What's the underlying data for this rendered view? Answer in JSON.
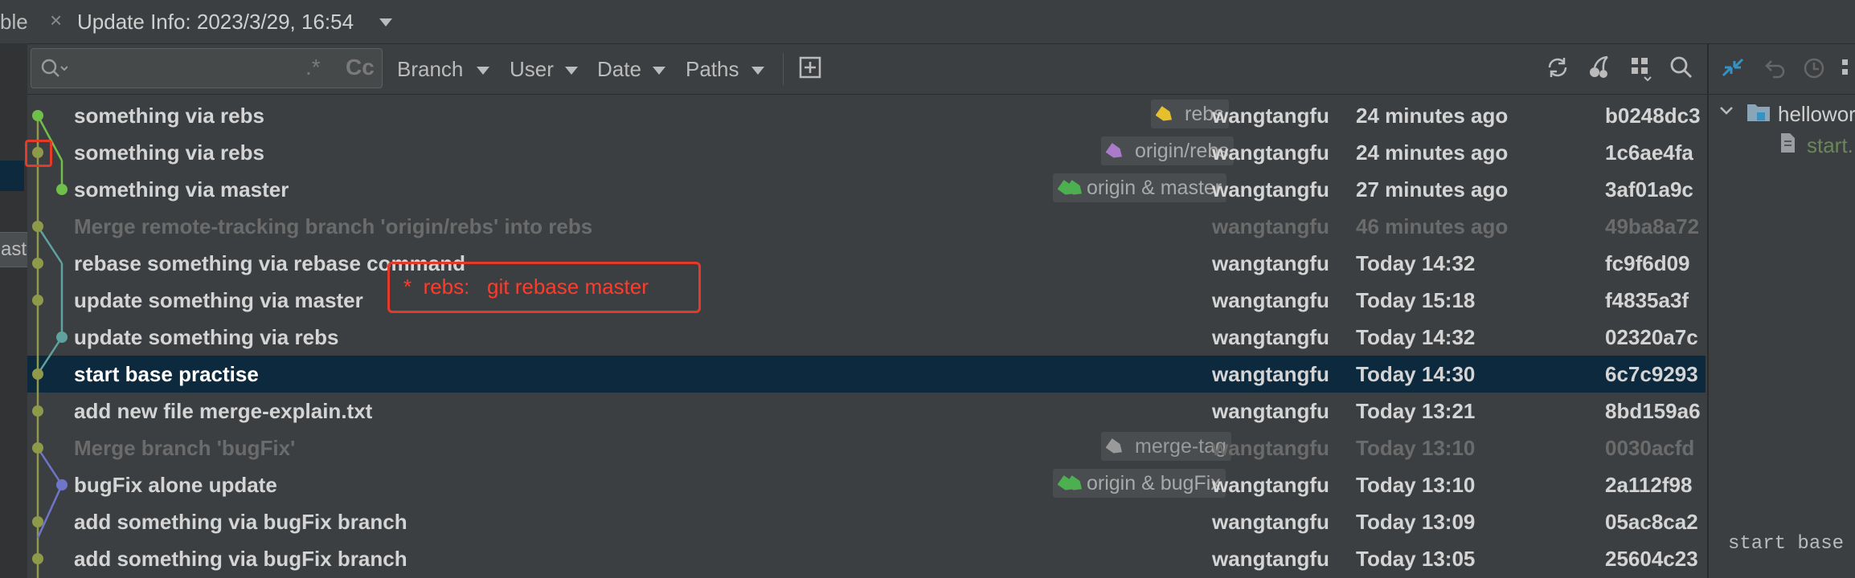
{
  "tabbar": {
    "prev_tab_label": "ble",
    "close_glyph": "×",
    "title": "Update Info: 2023/3/29, 16:54"
  },
  "tooltip": {
    "text": "aster"
  },
  "toolbar": {
    "search_placeholder": "",
    "regex_label": ".*",
    "case_label": "Cc",
    "filters": [
      {
        "label": "Branch"
      },
      {
        "label": "User"
      },
      {
        "label": "Date"
      },
      {
        "label": "Paths"
      }
    ],
    "icons": [
      "new-tab-icon",
      "refresh-icon",
      "cherry-pick-icon",
      "layout-options-icon",
      "search-icon"
    ]
  },
  "annotation": {
    "text": "*  rebs:   git rebase master"
  },
  "commits": [
    {
      "message": "something via rebs",
      "ref": "rebs",
      "ref_color": "#e5c02c",
      "author": "wangtangfu",
      "date": "24 minutes ago",
      "hash": "b0248dc3",
      "dim": false
    },
    {
      "message": "something via rebs",
      "ref": "origin/rebs",
      "ref_color": "#a97bc9",
      "author": "wangtangfu",
      "date": "24 minutes ago",
      "hash": "1c6ae4fa",
      "dim": false
    },
    {
      "message": "something via master",
      "ref": "origin & master",
      "ref_color": "#4caf50",
      "author": "wangtangfu",
      "date": "27 minutes ago",
      "hash": "3af01a9c",
      "dim": false
    },
    {
      "message": "Merge remote-tracking branch 'origin/rebs' into rebs",
      "ref": "",
      "author": "wangtangfu",
      "date": "46 minutes ago",
      "hash": "49ba8a72",
      "dim": true
    },
    {
      "message": "rebase something via rebase command",
      "ref": "",
      "author": "wangtangfu",
      "date": "Today 14:32",
      "hash": "fc9f6d09",
      "dim": false
    },
    {
      "message": "update something via master",
      "ref": "",
      "author": "wangtangfu",
      "date": "Today 15:18",
      "hash": "f4835a3f",
      "dim": false
    },
    {
      "message": "update something via rebs",
      "ref": "",
      "author": "wangtangfu",
      "date": "Today 14:32",
      "hash": "02320a7c",
      "dim": false
    },
    {
      "message": "start base practise",
      "ref": "",
      "author": "wangtangfu",
      "date": "Today 14:30",
      "hash": "6c7c9293",
      "dim": false,
      "selected": true
    },
    {
      "message": "add new file merge-explain.txt",
      "ref": "",
      "author": "wangtangfu",
      "date": "Today 13:21",
      "hash": "8bd159a6",
      "dim": false
    },
    {
      "message": "Merge branch 'bugFix'",
      "ref": "merge-tag",
      "ref_color": "#9a9a9a",
      "author": "wangtangfu",
      "date": "Today 13:10",
      "hash": "0030acfd",
      "dim": true
    },
    {
      "message": "bugFix alone update",
      "ref": "origin & bugFix",
      "ref_color": "#4caf50",
      "author": "wangtangfu",
      "date": "Today 13:10",
      "hash": "2a112f98",
      "dim": false
    },
    {
      "message": "add something via bugFix branch",
      "ref": "",
      "author": "wangtangfu",
      "date": "Today 13:09",
      "hash": "05ac8ca2",
      "dim": false
    },
    {
      "message": "add something via bugFix branch",
      "ref": "",
      "author": "wangtangfu",
      "date": "Today 13:05",
      "hash": "25604c23",
      "dim": false
    }
  ],
  "graph_colors": {
    "main": "#8e9a4a",
    "green": "#6fbf4a",
    "teal": "#5fa3a0",
    "blue": "#6f75c9"
  },
  "right_panel": {
    "tree_root": "hellowor",
    "tree_child": "start.",
    "preview_text": "start base"
  }
}
